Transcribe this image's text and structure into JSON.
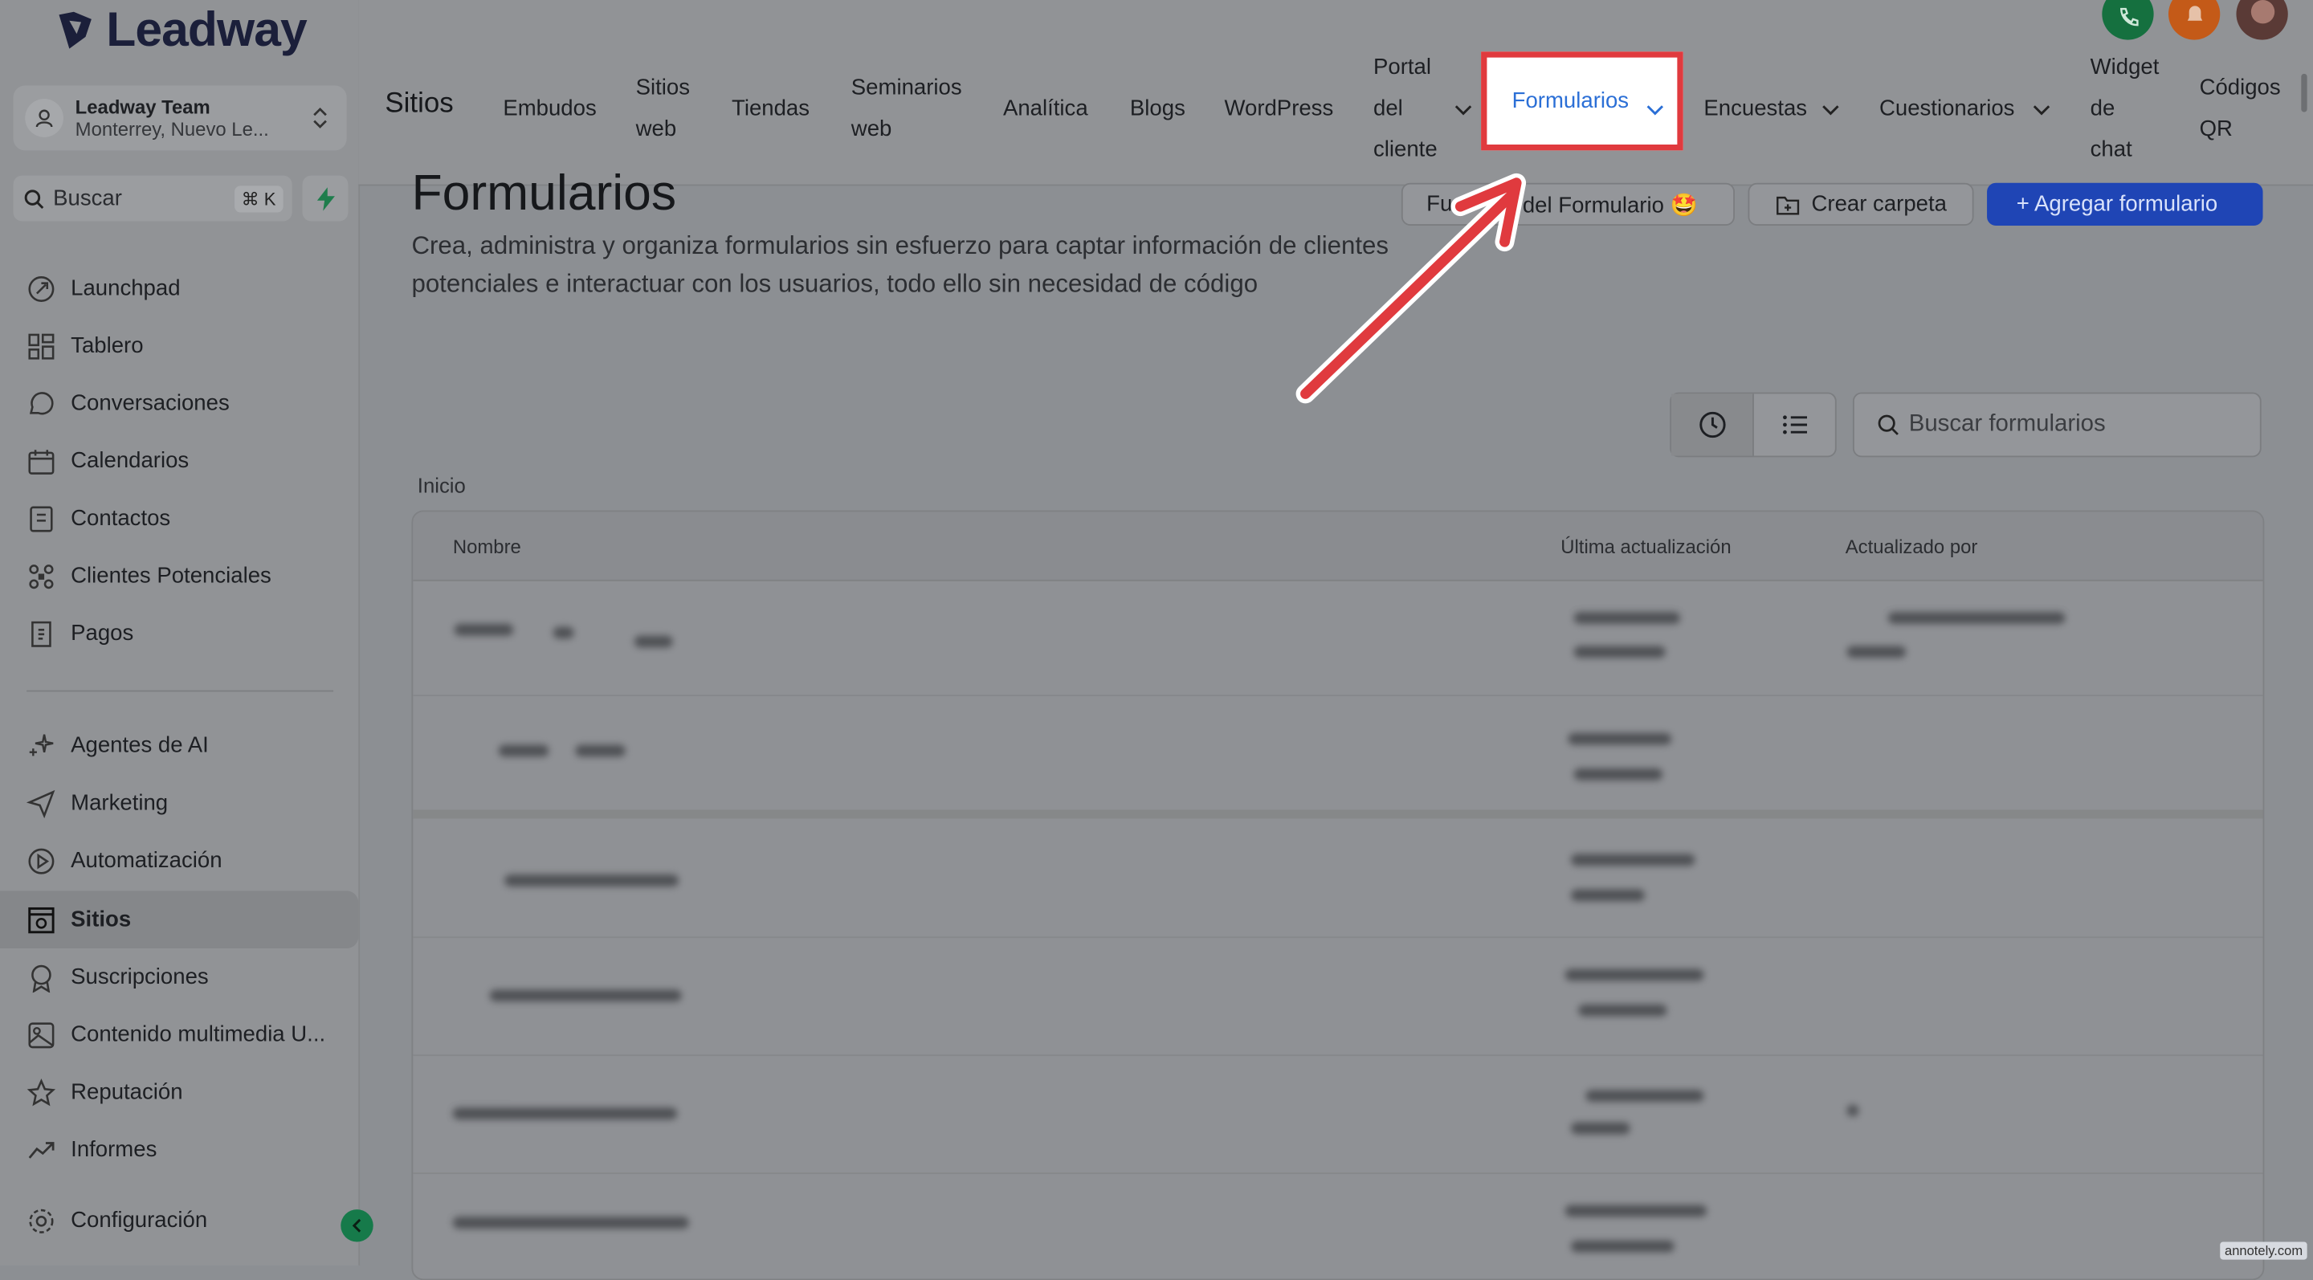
{
  "brand": {
    "name": "Leadway",
    "accent": "#e03a3e",
    "primary": "#1f45b5"
  },
  "account": {
    "name": "Leadway Team",
    "location": "Monterrey, Nuevo Le..."
  },
  "sidebar": {
    "search_placeholder": "Buscar",
    "search_shortcut": "⌘ K",
    "items_top": [
      {
        "label": "Launchpad",
        "icon": "rocket-icon"
      },
      {
        "label": "Tablero",
        "icon": "grid-icon"
      },
      {
        "label": "Conversaciones",
        "icon": "chat-icon"
      },
      {
        "label": "Calendarios",
        "icon": "calendar-icon"
      },
      {
        "label": "Contactos",
        "icon": "contacts-icon"
      },
      {
        "label": "Clientes Potenciales",
        "icon": "leads-icon"
      },
      {
        "label": "Pagos",
        "icon": "payments-icon"
      }
    ],
    "items_bottom": [
      {
        "label": "Agentes de AI",
        "icon": "sparkle-icon"
      },
      {
        "label": "Marketing",
        "icon": "send-icon"
      },
      {
        "label": "Automatización",
        "icon": "automation-icon"
      },
      {
        "label": "Sitios",
        "icon": "sites-icon",
        "active": true
      },
      {
        "label": "Suscripciones",
        "icon": "badge-icon"
      },
      {
        "label": "Contenido multimedia U...",
        "icon": "media-icon"
      },
      {
        "label": "Reputación",
        "icon": "star-icon"
      },
      {
        "label": "Informes",
        "icon": "chart-icon"
      }
    ],
    "settings_label": "Configuración"
  },
  "topnav": {
    "title": "Sitios",
    "links": {
      "embudos": "Embudos",
      "sitios_web_1": "Sitios",
      "sitios_web_2": "web",
      "tiendas": "Tiendas",
      "seminarios_1": "Seminarios",
      "seminarios_2": "web",
      "analitica": "Analítica",
      "blogs": "Blogs",
      "wordpress": "WordPress",
      "portal_1": "Portal",
      "portal_2": "del",
      "portal_3": "cliente",
      "formularios": "Formularios",
      "encuestas": "Encuestas",
      "cuestionarios": "Cuestionarios",
      "widget_1": "Widget",
      "widget_2": "de",
      "widget_3": "chat",
      "codigos_1": "Códigos",
      "codigos_2": "QR"
    }
  },
  "main": {
    "title": "Formularios",
    "description": "Crea, administra y organiza formularios sin esfuerzo para captar información de clientes potenciales e interactuar con los usuarios, todo ello sin necesidad de código",
    "btn_features_left": "Fu",
    "btn_features_right": "s del Formulario 🤩",
    "btn_folder": "Crear carpeta",
    "btn_add": "+ Agregar formulario",
    "search_placeholder": "Buscar formularios",
    "breadcrumb": "Inicio",
    "table": {
      "col_name": "Nombre",
      "col_updated": "Última actualización",
      "col_updated_by": "Actualizado por"
    }
  },
  "watermark": "annotely.com"
}
